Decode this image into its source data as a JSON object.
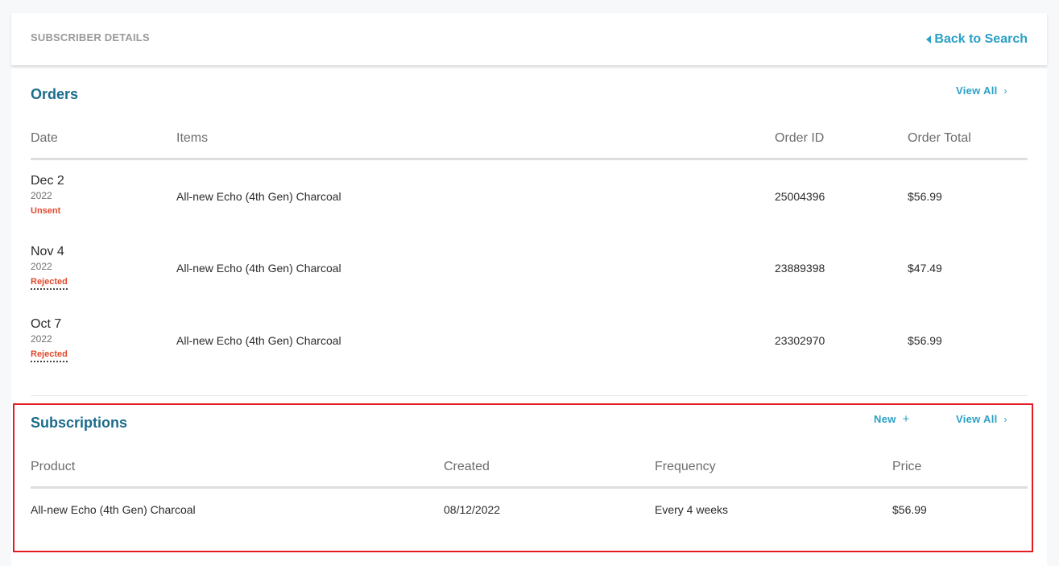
{
  "header": {
    "title": "SUBSCRIBER DETAILS",
    "back_label": "Back to Search"
  },
  "orders": {
    "title": "Orders",
    "view_all": "View All",
    "columns": [
      "Date",
      "Items",
      "Order ID",
      "Order Total"
    ],
    "rows": [
      {
        "date": "Dec 2",
        "year": "2022",
        "status": "Unsent",
        "item": "All-new Echo (4th Gen) Charcoal",
        "order_id": "25004396",
        "total": "$56.99"
      },
      {
        "date": "Nov 4",
        "year": "2022",
        "status": "Rejected",
        "item": "All-new Echo (4th Gen) Charcoal",
        "order_id": "23889398",
        "total": "$47.49"
      },
      {
        "date": "Oct 7",
        "year": "2022",
        "status": "Rejected",
        "item": "All-new Echo (4th Gen) Charcoal",
        "order_id": "23302970",
        "total": "$56.99"
      }
    ]
  },
  "subscriptions": {
    "title": "Subscriptions",
    "new_label": "New",
    "view_all": "View All",
    "columns": [
      "Product",
      "Created",
      "Frequency",
      "Price"
    ],
    "rows": [
      {
        "product": "All-new Echo (4th Gen) Charcoal",
        "created": "08/12/2022",
        "frequency": "Every 4 weeks",
        "price": "$56.99"
      }
    ]
  },
  "colors": {
    "accent": "#2aa0c6",
    "section_title": "#1c6c8b",
    "status_error": "#e0492d",
    "highlight_border": "#e31b23"
  }
}
